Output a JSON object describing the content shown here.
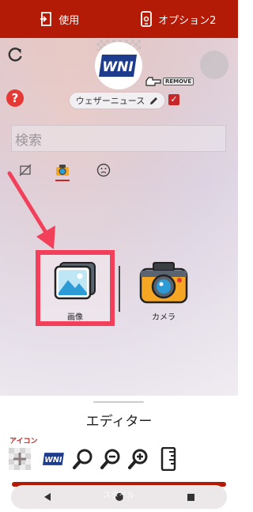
{
  "topbar": {
    "use_label": "使用",
    "options_label": "オプション2"
  },
  "header": {
    "logo_text": "WNI",
    "remove_label": "REMOVE",
    "name_chip": "ウェザーニュース",
    "checked": true
  },
  "search": {
    "placeholder": "検索"
  },
  "tabs": [
    {
      "icon": "no-image-icon",
      "selected": false
    },
    {
      "icon": "camera-icon",
      "selected": true
    },
    {
      "icon": "face-icon",
      "selected": false
    }
  ],
  "options": {
    "image_label": "画像",
    "camera_label": "カメラ"
  },
  "sheet": {
    "title": "エディター",
    "icon_section_label": "アイコン",
    "style_label": "スタイル"
  },
  "colors": {
    "brand_red": "#b31b06",
    "highlight": "#f2405a"
  }
}
